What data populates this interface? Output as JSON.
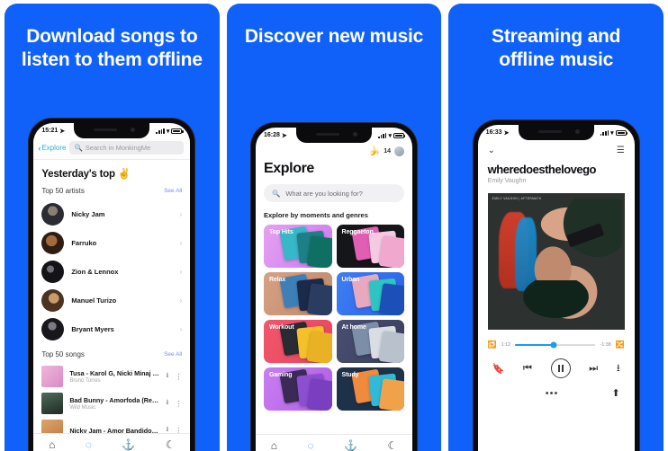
{
  "gallery": {
    "background_color": "#1061fa",
    "panels": [
      {
        "headline": "Download songs to listen to them offline",
        "phone": {
          "status": {
            "time": "15:21",
            "location_icon": "location-arrow-icon",
            "wifi_icon": "wifi-icon",
            "battery_icon": "battery-icon"
          },
          "nav": {
            "back_label": "Explore",
            "search_placeholder": "Search in MonkingMe",
            "search_icon": "search-icon"
          },
          "page_title": "Yesterday's top ✌️",
          "sections": [
            {
              "label": "Top 50 artists",
              "see_all": "See All",
              "artists": [
                {
                  "name": "Nicky Jam",
                  "avatar_color": "#3b3340"
                },
                {
                  "name": "Farruko",
                  "avatar_color": "#5a3a2a"
                },
                {
                  "name": "Zion & Lennox",
                  "avatar_color": "#1b1b20"
                },
                {
                  "name": "Manuel Turizo",
                  "avatar_color": "#7a5138"
                },
                {
                  "name": "Bryant Myers",
                  "avatar_color": "#23232c"
                }
              ]
            },
            {
              "label": "Top 50 songs",
              "see_all": "See All",
              "songs": [
                {
                  "title": "Tusa - Karol G, Nicki Minaj (Br...",
                  "subtitle": "Bruno Torres",
                  "cover_color": "#e8a7d0"
                },
                {
                  "title": "Bad Bunny - Amorfoda (Remix)",
                  "subtitle": "Wild Music",
                  "cover_color": "#2f4e46"
                },
                {
                  "title": "Nicky Jam - Amor Bandido (Re...",
                  "subtitle": "",
                  "cover_color": "#c98f5e"
                }
              ]
            }
          ],
          "tabs": [
            {
              "icon": "home-icon",
              "glyph": "⌂",
              "active": false
            },
            {
              "icon": "search-icon",
              "glyph": "◌",
              "active": true
            },
            {
              "icon": "anchor-icon",
              "glyph": "⚓",
              "active": false
            },
            {
              "icon": "moon-icon",
              "glyph": "☾",
              "active": false
            }
          ]
        }
      },
      {
        "headline": "Discover new music",
        "phone": {
          "status": {
            "time": "16:28",
            "location_icon": "location-arrow-icon",
            "wifi_icon": "wifi-icon",
            "battery_icon": "battery-icon"
          },
          "header": {
            "banana_icon": "banana-icon",
            "banana_count": "14",
            "avatar_icon": "user-avatar"
          },
          "page_title": "Explore",
          "search_placeholder": "What are you looking for?",
          "search_icon": "search-icon",
          "section_label": "Explore by moments and genres",
          "genres": [
            {
              "label": "Top Hits",
              "bg": "linear-gradient(120deg,#e8a0f0,#c77cf0)",
              "t1": "#38b7c9",
              "t2": "#1f7f86",
              "t3": "#0f6f63"
            },
            {
              "label": "Reggaeton",
              "bg": "#15161a",
              "t1": "#e05fb4",
              "t2": "#f6c9e2",
              "t3": "#f0a8cf"
            },
            {
              "label": "Relax",
              "bg": "linear-gradient(120deg,#d5a184,#c08a6a)",
              "t1": "#3f7fb8",
              "t2": "#1b2a4a",
              "t3": "#2b3c63"
            },
            {
              "label": "Urban",
              "bg": "linear-gradient(120deg,#3f7ef5,#2a63e8)",
              "t1": "#e8a8c0",
              "t2": "#2fc4c4",
              "t3": "#1c4fb8"
            },
            {
              "label": "Workout",
              "bg": "linear-gradient(120deg,#f2566b,#e8455e)",
              "t1": "#2a2a33",
              "t2": "#f4c12a",
              "t3": "#e8b224"
            },
            {
              "label": "At home",
              "bg": "linear-gradient(120deg,#4a4f72,#3a3f5e)",
              "t1": "#7d8ea8",
              "t2": "#d9dde4",
              "t3": "#b9c1cc"
            },
            {
              "label": "Gaming",
              "bg": "linear-gradient(120deg,#c97ef0,#b05fe8)",
              "t1": "#3a2a55",
              "t2": "#8c4fd0",
              "t3": "#7a3fc0"
            },
            {
              "label": "Study",
              "bg": "#1d3148",
              "t1": "#f08a3c",
              "t2": "#2fbad8",
              "t3": "#f0a24a"
            }
          ],
          "tabs": [
            {
              "icon": "home-icon",
              "glyph": "⌂",
              "active": false
            },
            {
              "icon": "search-icon",
              "glyph": "◌",
              "active": true
            },
            {
              "icon": "anchor-icon",
              "glyph": "⚓",
              "active": false
            },
            {
              "icon": "moon-icon",
              "glyph": "☾",
              "active": false
            }
          ]
        }
      },
      {
        "headline": "Streaming and offline music",
        "phone": {
          "status": {
            "time": "16:33",
            "location_icon": "location-arrow-icon",
            "wifi_icon": "wifi-icon",
            "battery_icon": "battery-icon"
          },
          "topbar": {
            "collapse_icon": "chevron-down-icon",
            "queue_icon": "list-icon"
          },
          "track_title": "wheredoesthelovego",
          "track_artist": "Emily Vaughn",
          "artwork_tag": "EMILY VAUGHN  |  AFTERMATH",
          "player": {
            "repeat_icon": "repeat-icon",
            "elapsed": "1:12",
            "remaining": "-1:38",
            "shuffle_icon": "shuffle-icon",
            "progress_percent": 48,
            "accent_color": "#1d9bf0",
            "controls": [
              {
                "icon": "bookmark-icon",
                "glyph": "🔖"
              },
              {
                "icon": "previous-track-icon",
                "glyph": "⏮"
              },
              {
                "icon": "pause-icon",
                "glyph": "⏸"
              },
              {
                "icon": "next-track-icon",
                "glyph": "⏭"
              },
              {
                "icon": "download-icon",
                "glyph": "⭳"
              }
            ],
            "more_icon": "more-dots-icon",
            "more_glyph": "•••",
            "share_icon": "share-icon"
          }
        }
      }
    ]
  }
}
